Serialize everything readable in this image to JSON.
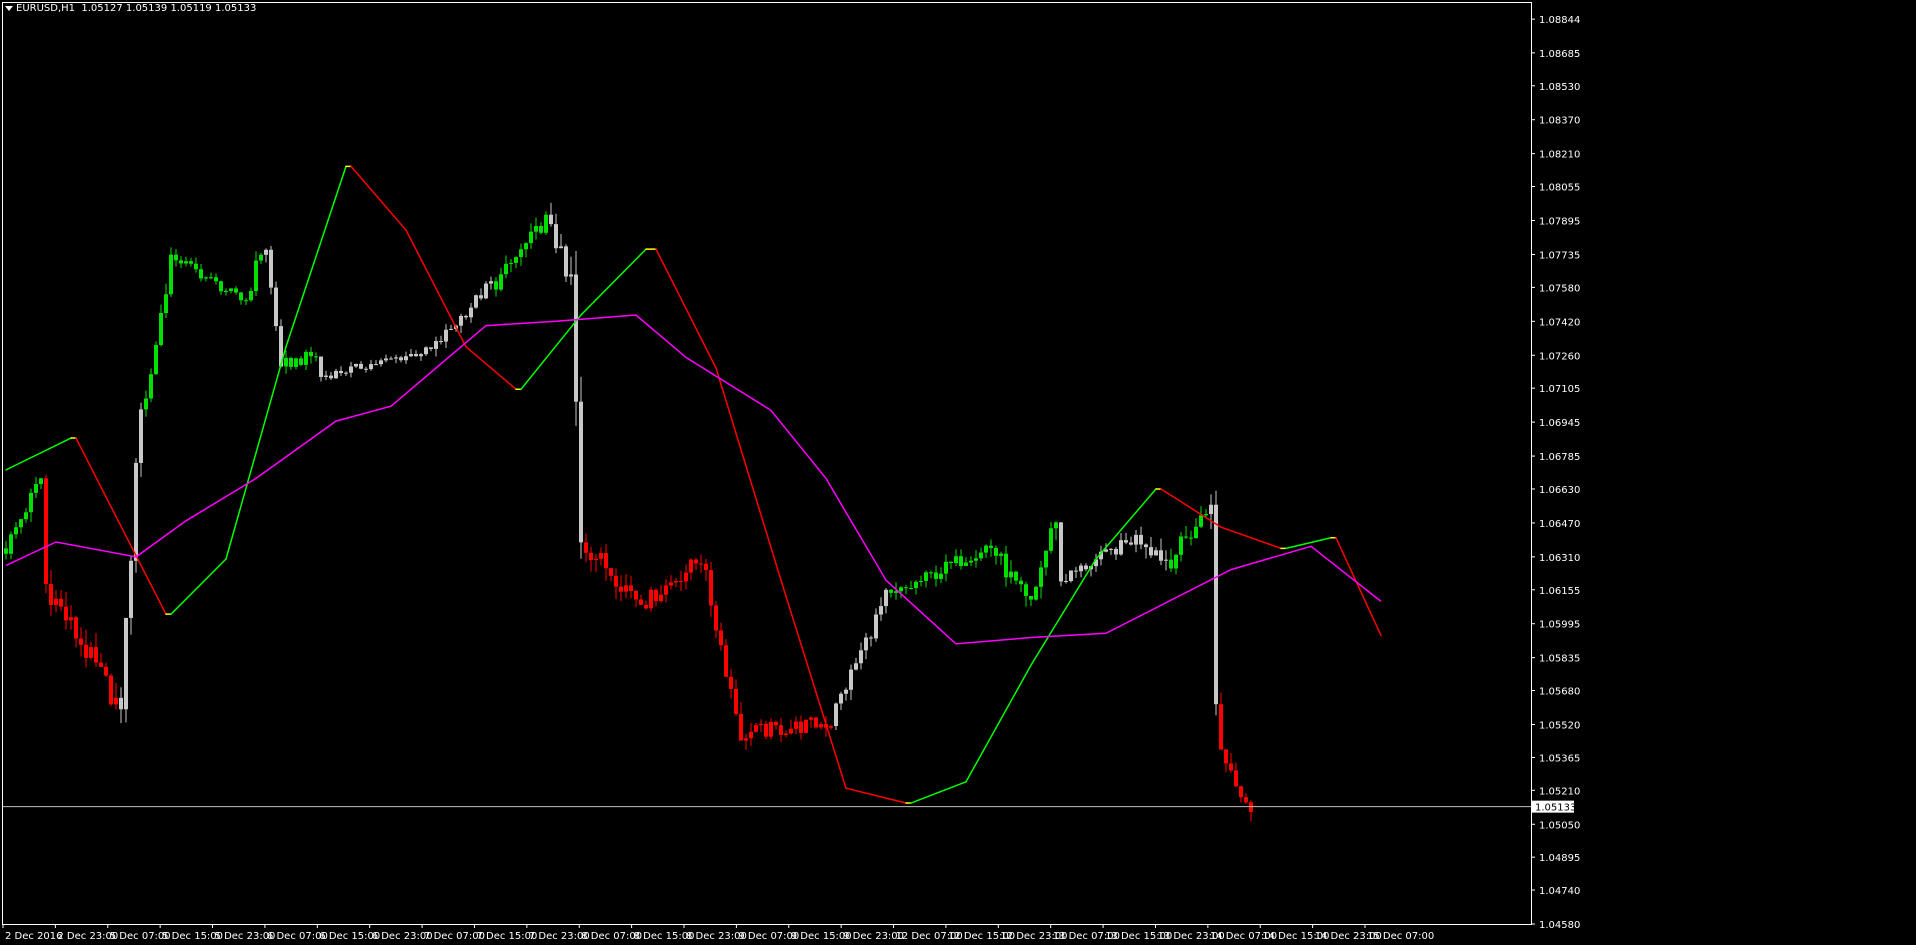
{
  "header": {
    "symbol": "EURUSD,H1",
    "ohlc": "1.05127 1.05139 1.05119 1.05133"
  },
  "colors": {
    "background": "#000000",
    "frame": "#ffffff",
    "bull_trend": "#00e000",
    "bear_trend": "#ff0000",
    "neutral": "#c8c8c8",
    "hull_up": "#00ff00",
    "hull_down": "#ff0000",
    "hull_turn": "#ffff00",
    "ma": "#ff00ff",
    "price_line": "#c0c0c0"
  },
  "chart_data": {
    "type": "candlestick",
    "symbol": "EURUSD",
    "timeframe": "H1",
    "current_price": 1.05133,
    "current_price_label": "1.05133",
    "ylim": [
      1.0458,
      1.0892
    ],
    "y_ticks": [
      "1.08844",
      "1.08685",
      "1.08530",
      "1.08370",
      "1.08210",
      "1.08055",
      "1.07895",
      "1.07735",
      "1.07580",
      "1.07420",
      "1.07260",
      "1.07105",
      "1.06945",
      "1.06785",
      "1.06630",
      "1.06470",
      "1.06310",
      "1.06155",
      "1.05995",
      "1.05835",
      "1.05680",
      "1.05520",
      "1.05365",
      "1.05210",
      "1.05050",
      "1.04895",
      "1.04740",
      "1.04580"
    ],
    "x_ticks": [
      "2 Dec 2016",
      "2 Dec 23:00",
      "5 Dec 07:00",
      "5 Dec 15:00",
      "5 Dec 23:00",
      "6 Dec 07:00",
      "6 Dec 15:00",
      "6 Dec 23:00",
      "7 Dec 07:00",
      "7 Dec 15:00",
      "7 Dec 23:00",
      "8 Dec 07:00",
      "8 Dec 15:00",
      "8 Dec 23:00",
      "9 Dec 07:00",
      "9 Dec 15:00",
      "9 Dec 23:00",
      "12 Dec 07:00",
      "12 Dec 15:00",
      "12 Dec 23:00",
      "13 Dec 07:00",
      "13 Dec 15:00",
      "13 Dec 23:00",
      "14 Dec 07:00",
      "14 Dec 15:00",
      "14 Dec 23:00",
      "15 Dec 07:00"
    ],
    "segments": [
      {
        "trend": "up",
        "from": 1.0635,
        "to": 1.0668,
        "bars": 8,
        "vol": 0.0008
      },
      {
        "trend": "down",
        "from": 1.0618,
        "to": 1.0563,
        "bars": 15,
        "vol": 0.0012
      },
      {
        "trend": "neutral",
        "from": 1.0563,
        "to": 1.0705,
        "bars": 5,
        "vol": 0.0014
      },
      {
        "trend": "up",
        "from": 1.0705,
        "to": 1.0772,
        "bars": 6,
        "vol": 0.001
      },
      {
        "trend": "up",
        "from": 1.0772,
        "to": 1.0752,
        "bars": 14,
        "vol": 0.0005
      },
      {
        "trend": "up",
        "from": 1.0752,
        "to": 1.0775,
        "bars": 4,
        "vol": 0.0008
      },
      {
        "trend": "neutral",
        "from": 1.0775,
        "to": 1.0722,
        "bars": 4,
        "vol": 0.0006
      },
      {
        "trend": "up",
        "from": 1.0722,
        "to": 1.0726,
        "bars": 7,
        "vol": 0.0006
      },
      {
        "trend": "neutral",
        "from": 1.0716,
        "to": 1.0728,
        "bars": 22,
        "vol": 0.0004
      },
      {
        "trend": "neutral",
        "from": 1.0728,
        "to": 1.076,
        "bars": 13,
        "vol": 0.0006
      },
      {
        "trend": "up",
        "from": 1.076,
        "to": 1.079,
        "bars": 11,
        "vol": 0.0007
      },
      {
        "trend": "neutral",
        "from": 1.079,
        "to": 1.0762,
        "bars": 4,
        "vol": 0.0012
      },
      {
        "trend": "neutral",
        "from": 1.0762,
        "to": 1.0636,
        "bars": 3,
        "vol": 0.002
      },
      {
        "trend": "down",
        "from": 1.0636,
        "to": 1.061,
        "bars": 12,
        "vol": 0.001
      },
      {
        "trend": "down",
        "from": 1.061,
        "to": 1.063,
        "bars": 12,
        "vol": 0.0008
      },
      {
        "trend": "down",
        "from": 1.062,
        "to": 1.0548,
        "bars": 8,
        "vol": 0.001
      },
      {
        "trend": "down",
        "from": 1.0548,
        "to": 1.0553,
        "bars": 18,
        "vol": 0.0008
      },
      {
        "trend": "neutral",
        "from": 1.056,
        "to": 1.0612,
        "bars": 11,
        "vol": 0.0008
      },
      {
        "trend": "up",
        "from": 1.0612,
        "to": 1.0636,
        "bars": 20,
        "vol": 0.0007
      },
      {
        "trend": "up",
        "from": 1.0636,
        "to": 1.061,
        "bars": 8,
        "vol": 0.0009
      },
      {
        "trend": "up",
        "from": 1.061,
        "to": 1.065,
        "bars": 6,
        "vol": 0.001
      },
      {
        "trend": "neutral",
        "from": 1.062,
        "to": 1.064,
        "bars": 16,
        "vol": 0.0006
      },
      {
        "trend": "neutral",
        "from": 1.064,
        "to": 1.063,
        "bars": 6,
        "vol": 0.001
      },
      {
        "trend": "up",
        "from": 1.063,
        "to": 1.0652,
        "bars": 8,
        "vol": 0.0009
      },
      {
        "trend": "neutral",
        "from": 1.0652,
        "to": 1.056,
        "bars": 2,
        "vol": 0.0015
      },
      {
        "trend": "down",
        "from": 1.054,
        "to": 1.0513,
        "bars": 7,
        "vol": 0.001
      }
    ],
    "hull_ma": [
      {
        "t": 0,
        "v": 1.0672,
        "c": "up"
      },
      {
        "t": 13,
        "v": 1.0687,
        "c": "up"
      },
      {
        "t": 14,
        "v": 1.0687,
        "c": "turn"
      },
      {
        "t": 22,
        "v": 1.065,
        "c": "down"
      },
      {
        "t": 32,
        "v": 1.0604,
        "c": "down"
      },
      {
        "t": 33,
        "v": 1.0604,
        "c": "turn"
      },
      {
        "t": 44,
        "v": 1.063,
        "c": "up"
      },
      {
        "t": 56,
        "v": 1.073,
        "c": "up"
      },
      {
        "t": 68,
        "v": 1.0815,
        "c": "up"
      },
      {
        "t": 69,
        "v": 1.0815,
        "c": "turn"
      },
      {
        "t": 80,
        "v": 1.0785,
        "c": "down"
      },
      {
        "t": 92,
        "v": 1.073,
        "c": "down"
      },
      {
        "t": 102,
        "v": 1.071,
        "c": "down"
      },
      {
        "t": 103,
        "v": 1.071,
        "c": "turn"
      },
      {
        "t": 115,
        "v": 1.0745,
        "c": "up"
      },
      {
        "t": 128,
        "v": 1.0776,
        "c": "up"
      },
      {
        "t": 130,
        "v": 1.0776,
        "c": "turn"
      },
      {
        "t": 142,
        "v": 1.072,
        "c": "down"
      },
      {
        "t": 155,
        "v": 1.062,
        "c": "down"
      },
      {
        "t": 168,
        "v": 1.0522,
        "c": "down"
      },
      {
        "t": 180,
        "v": 1.0515,
        "c": "down"
      },
      {
        "t": 181,
        "v": 1.0515,
        "c": "turn"
      },
      {
        "t": 192,
        "v": 1.0525,
        "c": "up"
      },
      {
        "t": 205,
        "v": 1.058,
        "c": "up"
      },
      {
        "t": 218,
        "v": 1.063,
        "c": "up"
      },
      {
        "t": 230,
        "v": 1.0663,
        "c": "up"
      },
      {
        "t": 231,
        "v": 1.0663,
        "c": "turn"
      },
      {
        "t": 243,
        "v": 1.0645,
        "c": "down"
      },
      {
        "t": 255,
        "v": 1.0635,
        "c": "down"
      },
      {
        "t": 256,
        "v": 1.0635,
        "c": "turn"
      },
      {
        "t": 265,
        "v": 1.064,
        "c": "up"
      },
      {
        "t": 266,
        "v": 1.064,
        "c": "turn"
      },
      {
        "t": 275,
        "v": 1.0594,
        "c": "down"
      }
    ],
    "ma": [
      {
        "t": 0,
        "v": 1.0627
      },
      {
        "t": 10,
        "v": 1.0638
      },
      {
        "t": 26,
        "v": 1.0631
      },
      {
        "t": 36,
        "v": 1.0648
      },
      {
        "t": 50,
        "v": 1.0668
      },
      {
        "t": 66,
        "v": 1.0695
      },
      {
        "t": 77,
        "v": 1.0702
      },
      {
        "t": 96,
        "v": 1.074
      },
      {
        "t": 110,
        "v": 1.0742
      },
      {
        "t": 126,
        "v": 1.0745
      },
      {
        "t": 136,
        "v": 1.0725
      },
      {
        "t": 153,
        "v": 1.07
      },
      {
        "t": 164,
        "v": 1.0668
      },
      {
        "t": 176,
        "v": 1.062
      },
      {
        "t": 190,
        "v": 1.059
      },
      {
        "t": 205,
        "v": 1.0593
      },
      {
        "t": 220,
        "v": 1.0595
      },
      {
        "t": 245,
        "v": 1.0625
      },
      {
        "t": 261,
        "v": 1.0636
      },
      {
        "t": 275,
        "v": 1.061
      }
    ]
  }
}
